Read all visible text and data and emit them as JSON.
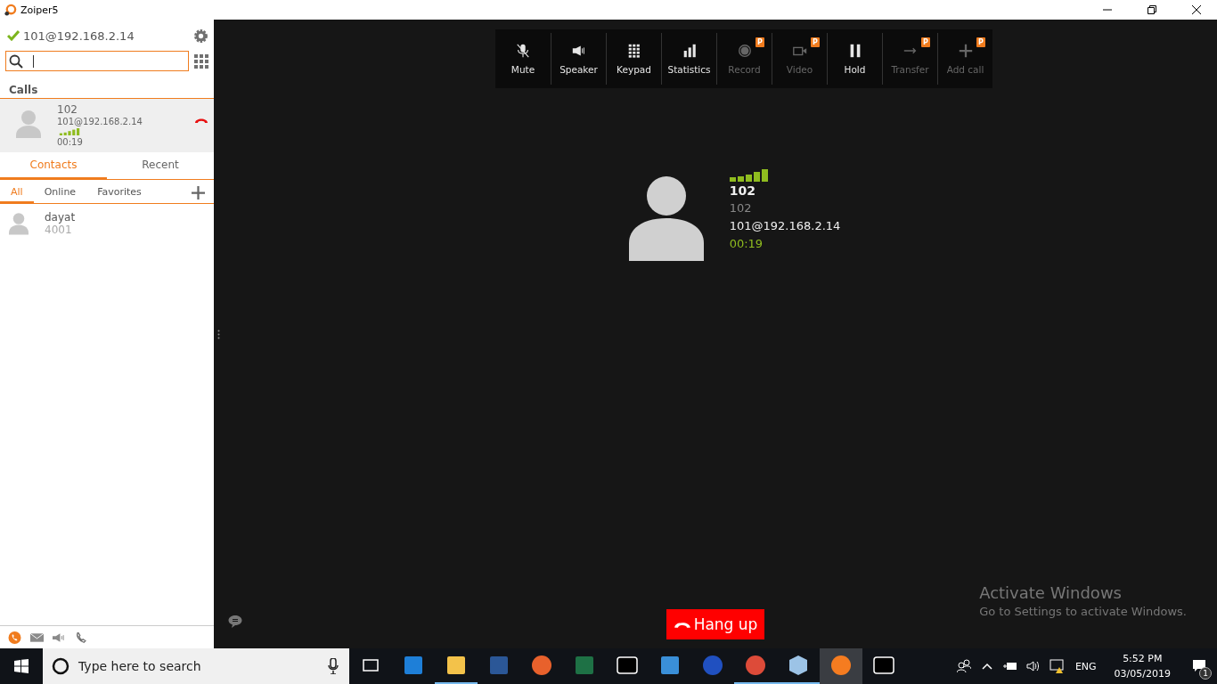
{
  "window": {
    "title": "Zoiper5"
  },
  "account": {
    "address": "101@192.168.2.14",
    "registered": true
  },
  "search": {
    "cursor": true
  },
  "calls": {
    "heading": "Calls",
    "items": [
      {
        "name": "102",
        "address": "101@192.168.2.14",
        "duration": "00:19",
        "selected": true
      }
    ]
  },
  "tabs": [
    {
      "label": "Contacts",
      "selected": true
    },
    {
      "label": "Recent",
      "selected": false
    }
  ],
  "filters": [
    {
      "label": "All",
      "selected": true
    },
    {
      "label": "Online",
      "selected": false
    },
    {
      "label": "Favorites",
      "selected": false
    }
  ],
  "contacts": [
    {
      "name": "dayat",
      "number": "4001"
    }
  ],
  "toolbar": [
    {
      "label": "Mute",
      "disabled": false,
      "premium": false
    },
    {
      "label": "Speaker",
      "disabled": false,
      "premium": false
    },
    {
      "label": "Keypad",
      "disabled": false,
      "premium": false
    },
    {
      "label": "Statistics",
      "disabled": false,
      "premium": false
    },
    {
      "label": "Record",
      "disabled": true,
      "premium": true,
      "badge": "P"
    },
    {
      "label": "Video",
      "disabled": true,
      "premium": true,
      "badge": "P"
    },
    {
      "label": "Hold",
      "disabled": false,
      "premium": false
    },
    {
      "label": "Transfer",
      "disabled": true,
      "premium": true,
      "badge": "P"
    },
    {
      "label": "Add call",
      "disabled": true,
      "premium": true,
      "badge": "P"
    }
  ],
  "caller": {
    "name": "102",
    "number": "102",
    "account": "101@192.168.2.14",
    "duration": "00:19"
  },
  "hangup": {
    "label": "Hang up"
  },
  "activation": {
    "title": "Activate Windows",
    "message": "Go to Settings to activate Windows."
  },
  "taskbar": {
    "search_placeholder": "Type here to search",
    "apps": [
      {
        "running": false,
        "selected": false
      },
      {
        "running": false,
        "selected": false
      },
      {
        "running": true,
        "selected": false
      },
      {
        "running": false,
        "selected": false
      },
      {
        "running": false,
        "selected": false
      },
      {
        "running": false,
        "selected": false
      },
      {
        "running": false,
        "selected": false
      },
      {
        "running": false,
        "selected": false
      },
      {
        "running": false,
        "selected": false
      },
      {
        "running": true,
        "selected": false
      },
      {
        "running": true,
        "selected": false
      },
      {
        "running": true,
        "selected": true
      },
      {
        "running": false,
        "selected": false
      }
    ],
    "language": "ENG",
    "time": "5:52 PM",
    "date": "03/05/2019",
    "notifications": "1"
  }
}
